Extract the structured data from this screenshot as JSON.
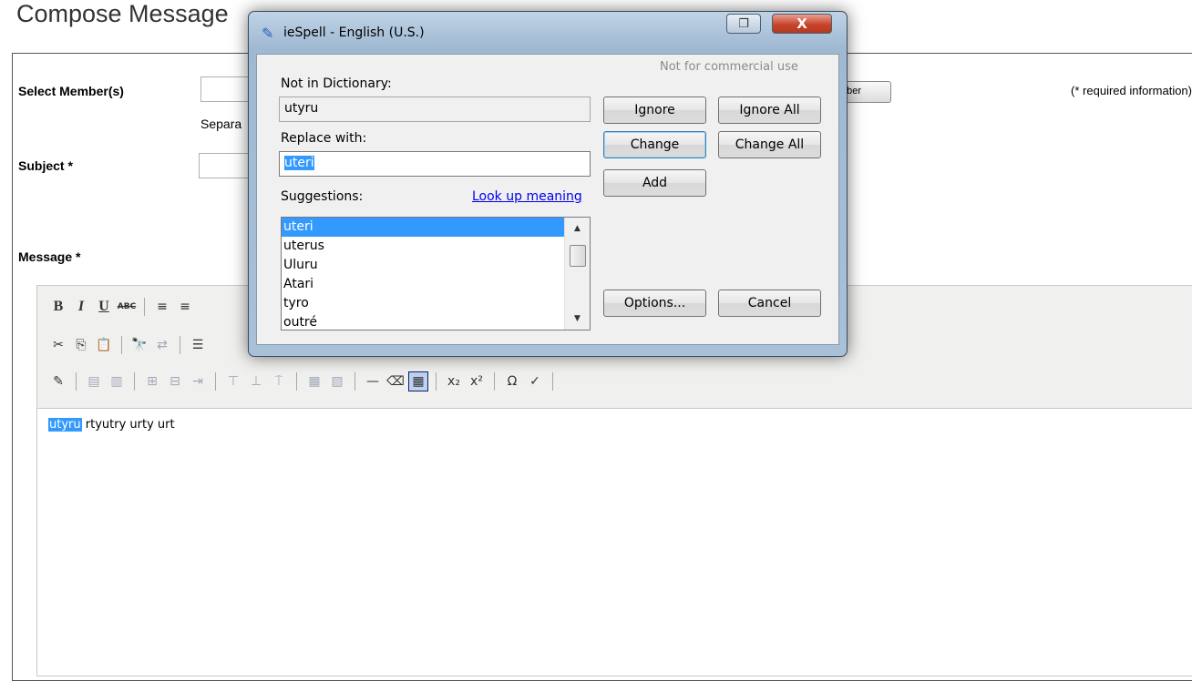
{
  "page": {
    "title": "Compose Message",
    "required_info": "(* required information)",
    "select_members_label": "Select Member(s)",
    "separator_hint": "Separa",
    "member_button_partial": "nber",
    "subject_label": "Subject *",
    "message_label": "Message *"
  },
  "editor": {
    "toolbar_row1": [
      {
        "name": "bold-button",
        "glyph": "B",
        "cls": "bold"
      },
      {
        "name": "italic-button",
        "glyph": "I",
        "cls": "ital"
      },
      {
        "name": "underline-button",
        "glyph": "U",
        "cls": "und"
      },
      {
        "name": "strikethrough-button",
        "glyph": "ABC",
        "cls": "strk"
      },
      {
        "sep": true
      },
      {
        "name": "align-left-button",
        "glyph": "≡",
        "cls": ""
      },
      {
        "name": "align-center-button",
        "glyph": "≡",
        "cls": ""
      }
    ],
    "toolbar_row2": [
      {
        "name": "cut-icon",
        "glyph": "✂",
        "cls": ""
      },
      {
        "name": "copy-icon",
        "glyph": "⎘",
        "cls": ""
      },
      {
        "name": "paste-icon",
        "glyph": "📋",
        "cls": ""
      },
      {
        "sep": true
      },
      {
        "name": "find-icon",
        "glyph": "🔭",
        "cls": ""
      },
      {
        "name": "replace-icon",
        "glyph": "⇄",
        "cls": "dim"
      },
      {
        "sep": true
      },
      {
        "name": "list-icon",
        "glyph": "☰",
        "cls": ""
      }
    ],
    "toolbar_row3": [
      {
        "name": "edit-source-icon",
        "glyph": "✎",
        "cls": ""
      },
      {
        "sep": true
      },
      {
        "name": "insert-row-icon",
        "glyph": "▤",
        "cls": "dim"
      },
      {
        "name": "delete-row-icon",
        "glyph": "▥",
        "cls": "dim"
      },
      {
        "sep": true
      },
      {
        "name": "insert-col-before-icon",
        "glyph": "⊞",
        "cls": "dim"
      },
      {
        "name": "insert-col-after-icon",
        "glyph": "⊟",
        "cls": "dim"
      },
      {
        "name": "delete-col-icon",
        "glyph": "⇥",
        "cls": "dim"
      },
      {
        "sep": true
      },
      {
        "name": "split-cell-icon",
        "glyph": "⊤",
        "cls": "dim"
      },
      {
        "name": "merge-cell-icon",
        "glyph": "⊥",
        "cls": "dim"
      },
      {
        "name": "cell-props-icon",
        "glyph": "⍑",
        "cls": "dim"
      },
      {
        "sep": true
      },
      {
        "name": "table-props-icon",
        "glyph": "▦",
        "cls": "dim"
      },
      {
        "name": "row-props-icon",
        "glyph": "▧",
        "cls": "dim"
      },
      {
        "sep": true
      },
      {
        "name": "horizontal-rule-icon",
        "glyph": "—",
        "cls": ""
      },
      {
        "name": "eraser-icon",
        "glyph": "⌫",
        "cls": ""
      },
      {
        "name": "table-icon",
        "glyph": "▦",
        "cls": "active"
      },
      {
        "sep": true
      },
      {
        "name": "subscript-icon",
        "glyph": "x₂",
        "cls": ""
      },
      {
        "name": "superscript-icon",
        "glyph": "x²",
        "cls": ""
      },
      {
        "sep": true
      },
      {
        "name": "special-char-icon",
        "glyph": "Ω",
        "cls": ""
      },
      {
        "name": "spellcheck-icon",
        "glyph": "✓",
        "cls": ""
      },
      {
        "sep": true
      }
    ],
    "content_selected_word": "utyru",
    "content_rest": " rtyutry urty urt"
  },
  "dialog": {
    "title": "ieSpell - English (U.S.)",
    "notice": "Not for commercial use",
    "not_in_dict_label": "Not in Dictionary:",
    "not_in_dict_value": "utyru",
    "replace_label": "Replace with:",
    "replace_value": "uteri",
    "suggestions_label": "Suggestions:",
    "lookup_link": "Look up meaning",
    "suggestions": [
      "uteri",
      "uterus",
      "Uluru",
      "Atari",
      "tyro",
      "outré"
    ],
    "selected_suggestion": "uteri",
    "buttons": {
      "ignore": "Ignore",
      "ignore_all": "Ignore All",
      "change": "Change",
      "change_all": "Change All",
      "add": "Add",
      "options": "Options...",
      "cancel": "Cancel"
    },
    "close_glyph": "X",
    "restore_glyph": "❐"
  }
}
